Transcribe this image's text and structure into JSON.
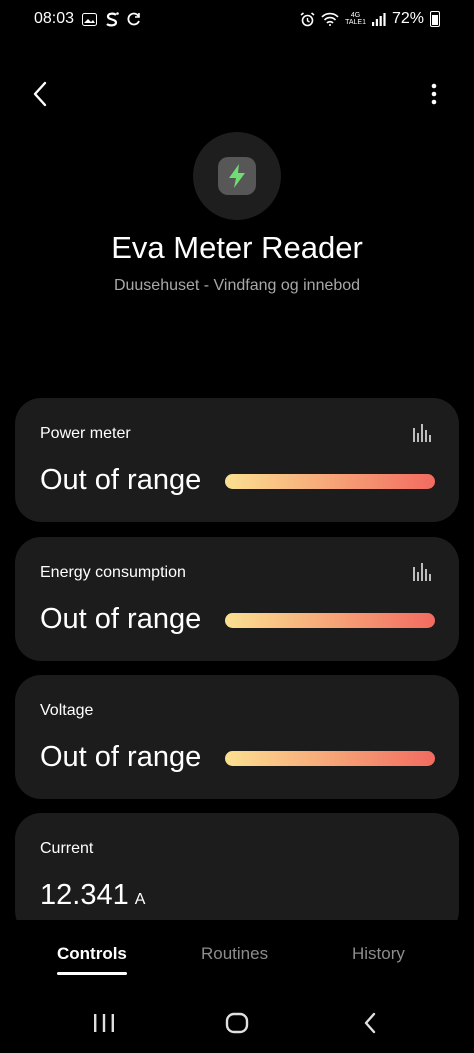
{
  "status_bar": {
    "time": "08:03",
    "battery": "72%",
    "network_top": "4G",
    "network_bottom": "TALE1"
  },
  "device": {
    "name": "Eva Meter Reader",
    "location": "Duusehuset - Vindfang og innebod",
    "icon": "lightning-bolt-icon"
  },
  "cards": [
    {
      "label": "Power meter",
      "value": "Out of range",
      "has_chart_icon": true
    },
    {
      "label": "Energy consumption",
      "value": "Out of range",
      "has_chart_icon": true
    },
    {
      "label": "Voltage",
      "value": "Out of range",
      "has_chart_icon": false
    },
    {
      "label": "Current",
      "value": "12.341",
      "unit": "A",
      "has_chart_icon": false
    }
  ],
  "tabs": [
    {
      "label": "Controls",
      "active": true
    },
    {
      "label": "Routines",
      "active": false
    },
    {
      "label": "History",
      "active": false
    }
  ],
  "colors": {
    "background": "#000000",
    "card": "#1c1c1c",
    "bar_start": "#fbe091",
    "bar_end": "#f26b60",
    "bolt": "#6fdc74",
    "subtitle": "#a8a8a8",
    "tab_inactive": "#8c8c8c"
  }
}
